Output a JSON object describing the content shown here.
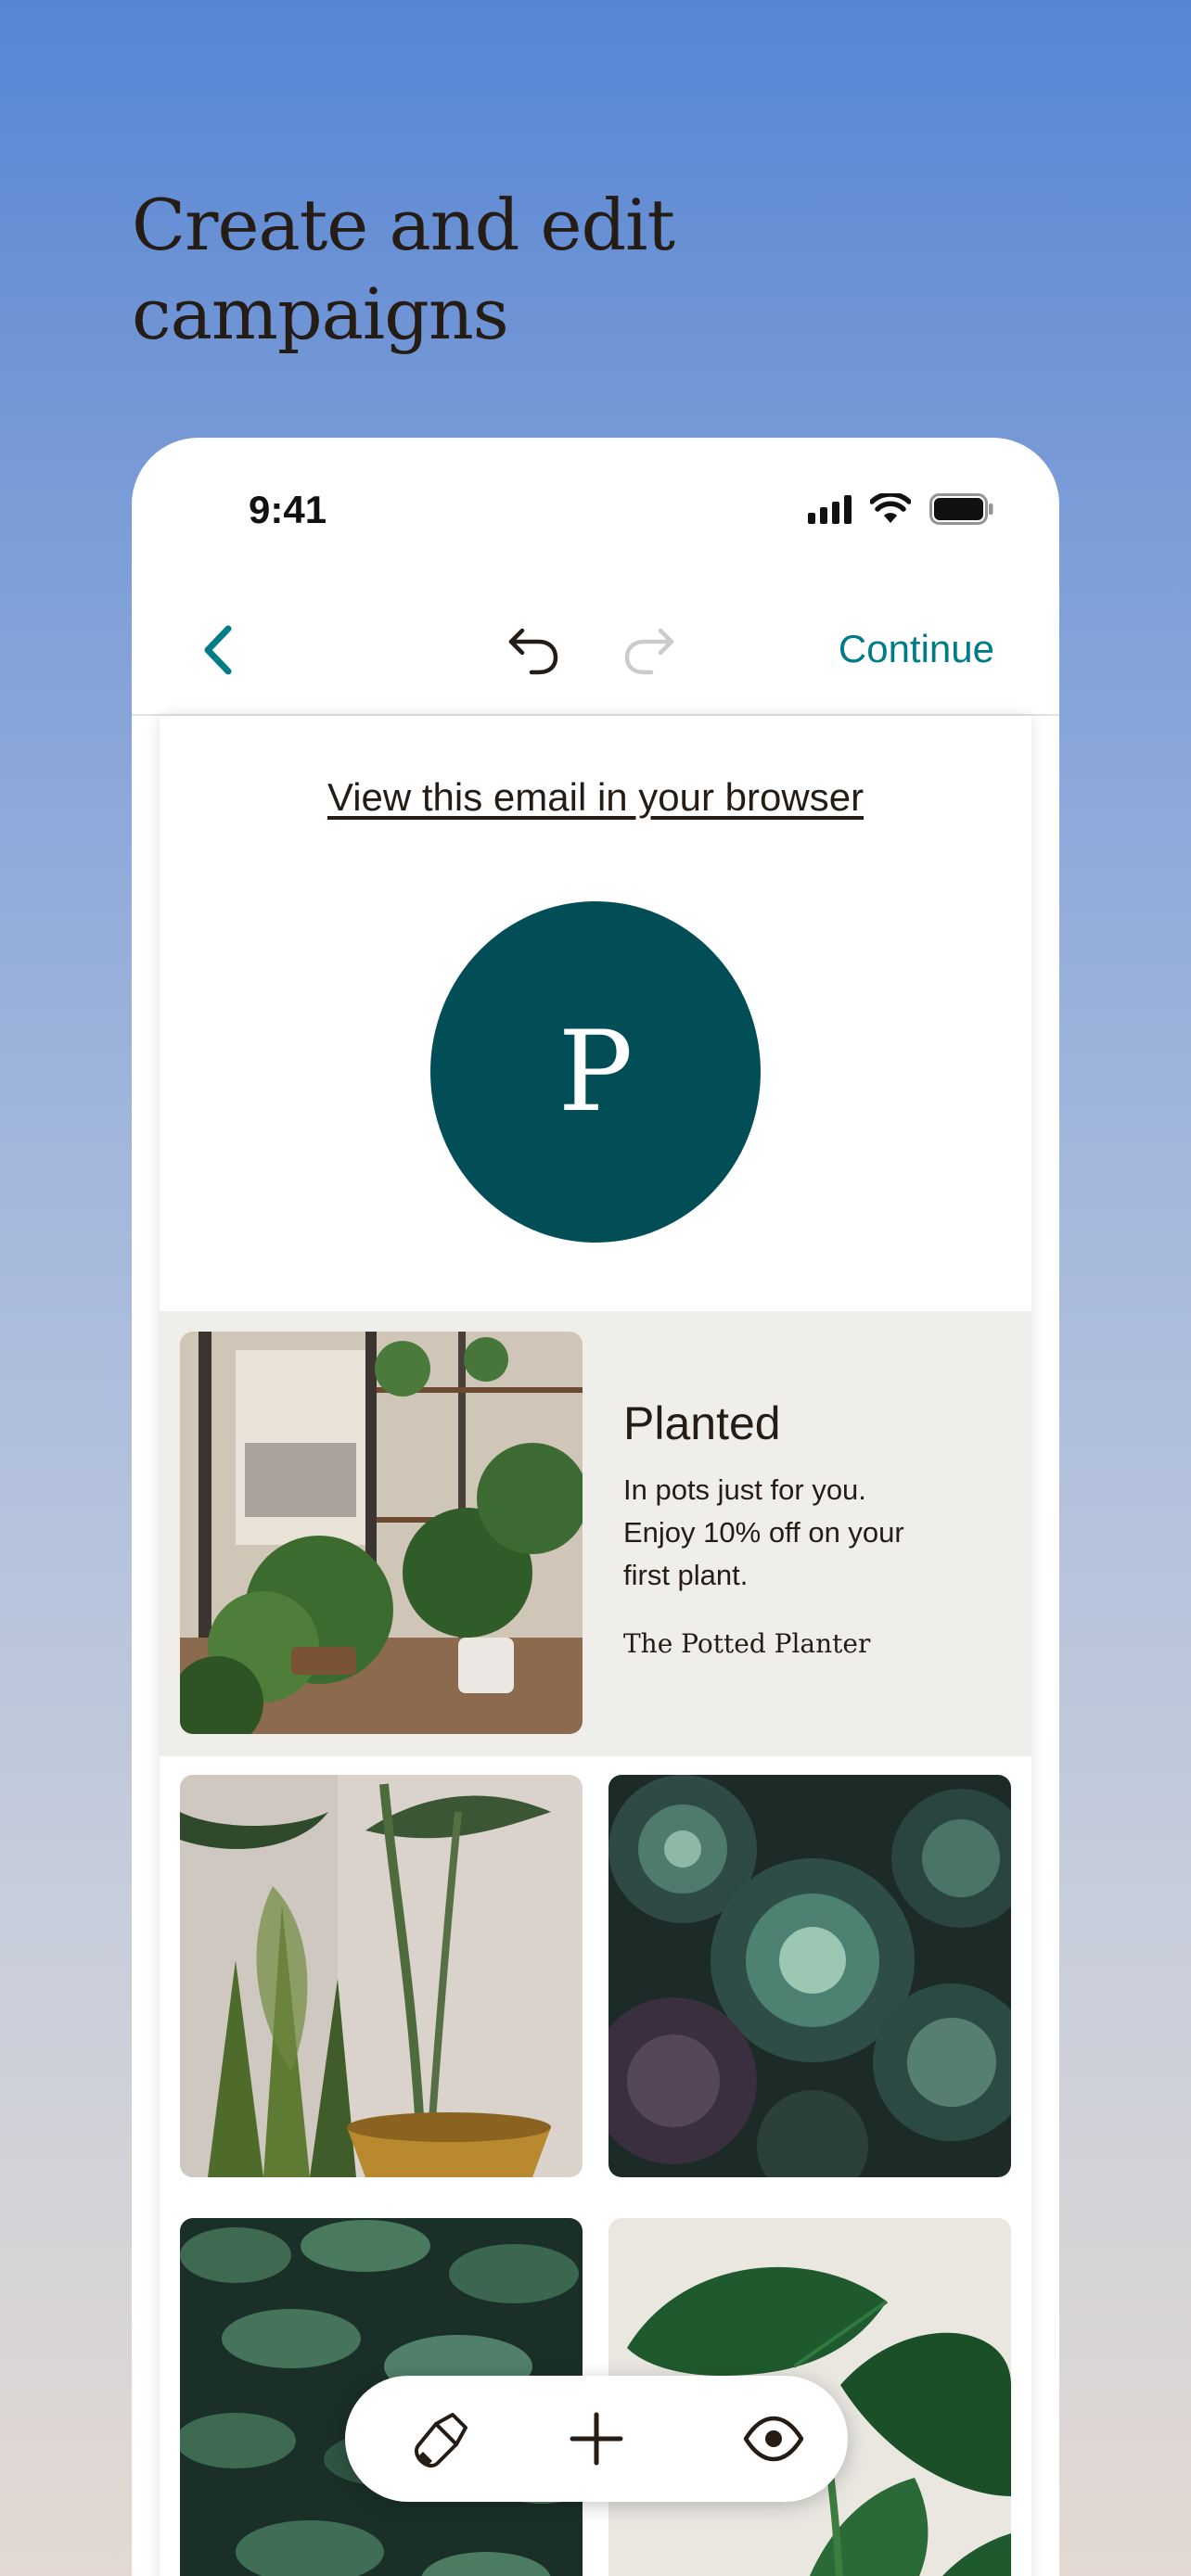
{
  "headline": {
    "line1": "Create and edit",
    "line2": "campaigns"
  },
  "status_bar": {
    "time": "9:41"
  },
  "nav": {
    "back_icon": "chevron-left-icon",
    "undo_icon": "undo-icon",
    "redo_icon": "redo-icon",
    "continue_label": "Continue"
  },
  "email": {
    "view_in_browser": "View this email in your browser",
    "logo_letter": "P",
    "promo": {
      "title": "Planted",
      "body_lines": [
        "In pots just for you.",
        "Enjoy 10% off on your",
        "first plant."
      ],
      "brand": "The Potted Planter"
    }
  },
  "toolbar": {
    "items": [
      "style-icon",
      "add-icon",
      "preview-eye-icon"
    ]
  },
  "colors": {
    "accent": "#007c89",
    "logo_bg": "#024e57",
    "text": "#241c15",
    "promo_bg": "#efeeeb",
    "redo_disabled": "#c9cbcc"
  }
}
